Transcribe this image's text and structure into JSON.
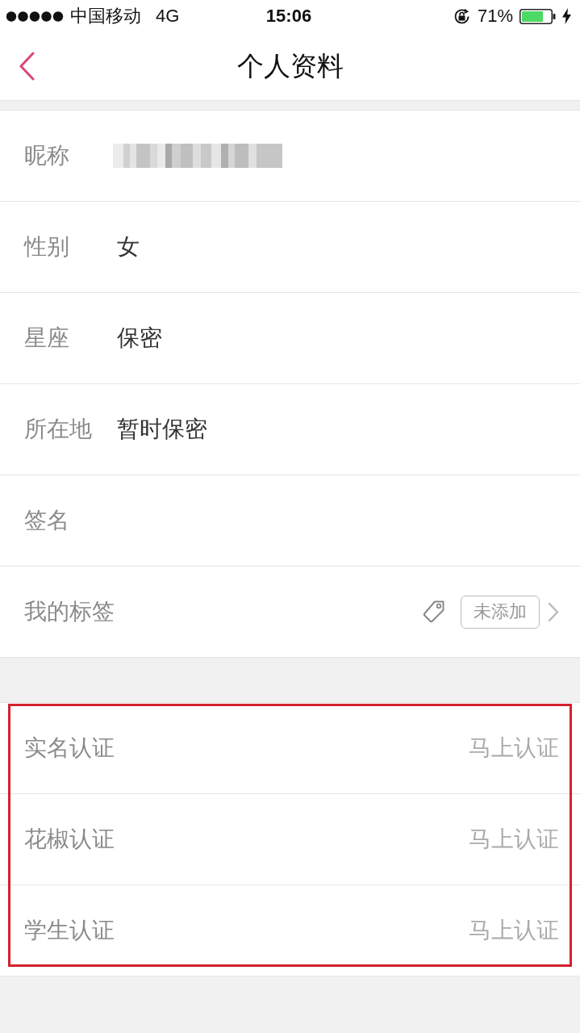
{
  "status_bar": {
    "carrier": "中国移动",
    "network": "4G",
    "time": "15:06",
    "battery_percent": "71%",
    "rotation_lock": true,
    "charging": true
  },
  "nav": {
    "title": "个人资料"
  },
  "sections": [
    {
      "highlighted": false,
      "rows": [
        {
          "kind": "redacted",
          "label": "昵称"
        },
        {
          "kind": "value",
          "label": "性别",
          "value": "女"
        },
        {
          "kind": "value",
          "label": "星座",
          "value": "保密"
        },
        {
          "kind": "value",
          "label": "所在地",
          "value": "暂时保密"
        },
        {
          "kind": "value",
          "label": "签名"
        },
        {
          "kind": "tags",
          "label": "我的标签",
          "tag_button": "未添加"
        }
      ]
    },
    {
      "highlighted": true,
      "rows": [
        {
          "kind": "action",
          "label": "实名认证",
          "action": "马上认证"
        },
        {
          "kind": "action",
          "label": "花椒认证",
          "action": "马上认证"
        },
        {
          "kind": "action",
          "label": "学生认证",
          "action": "马上认证"
        }
      ]
    }
  ]
}
